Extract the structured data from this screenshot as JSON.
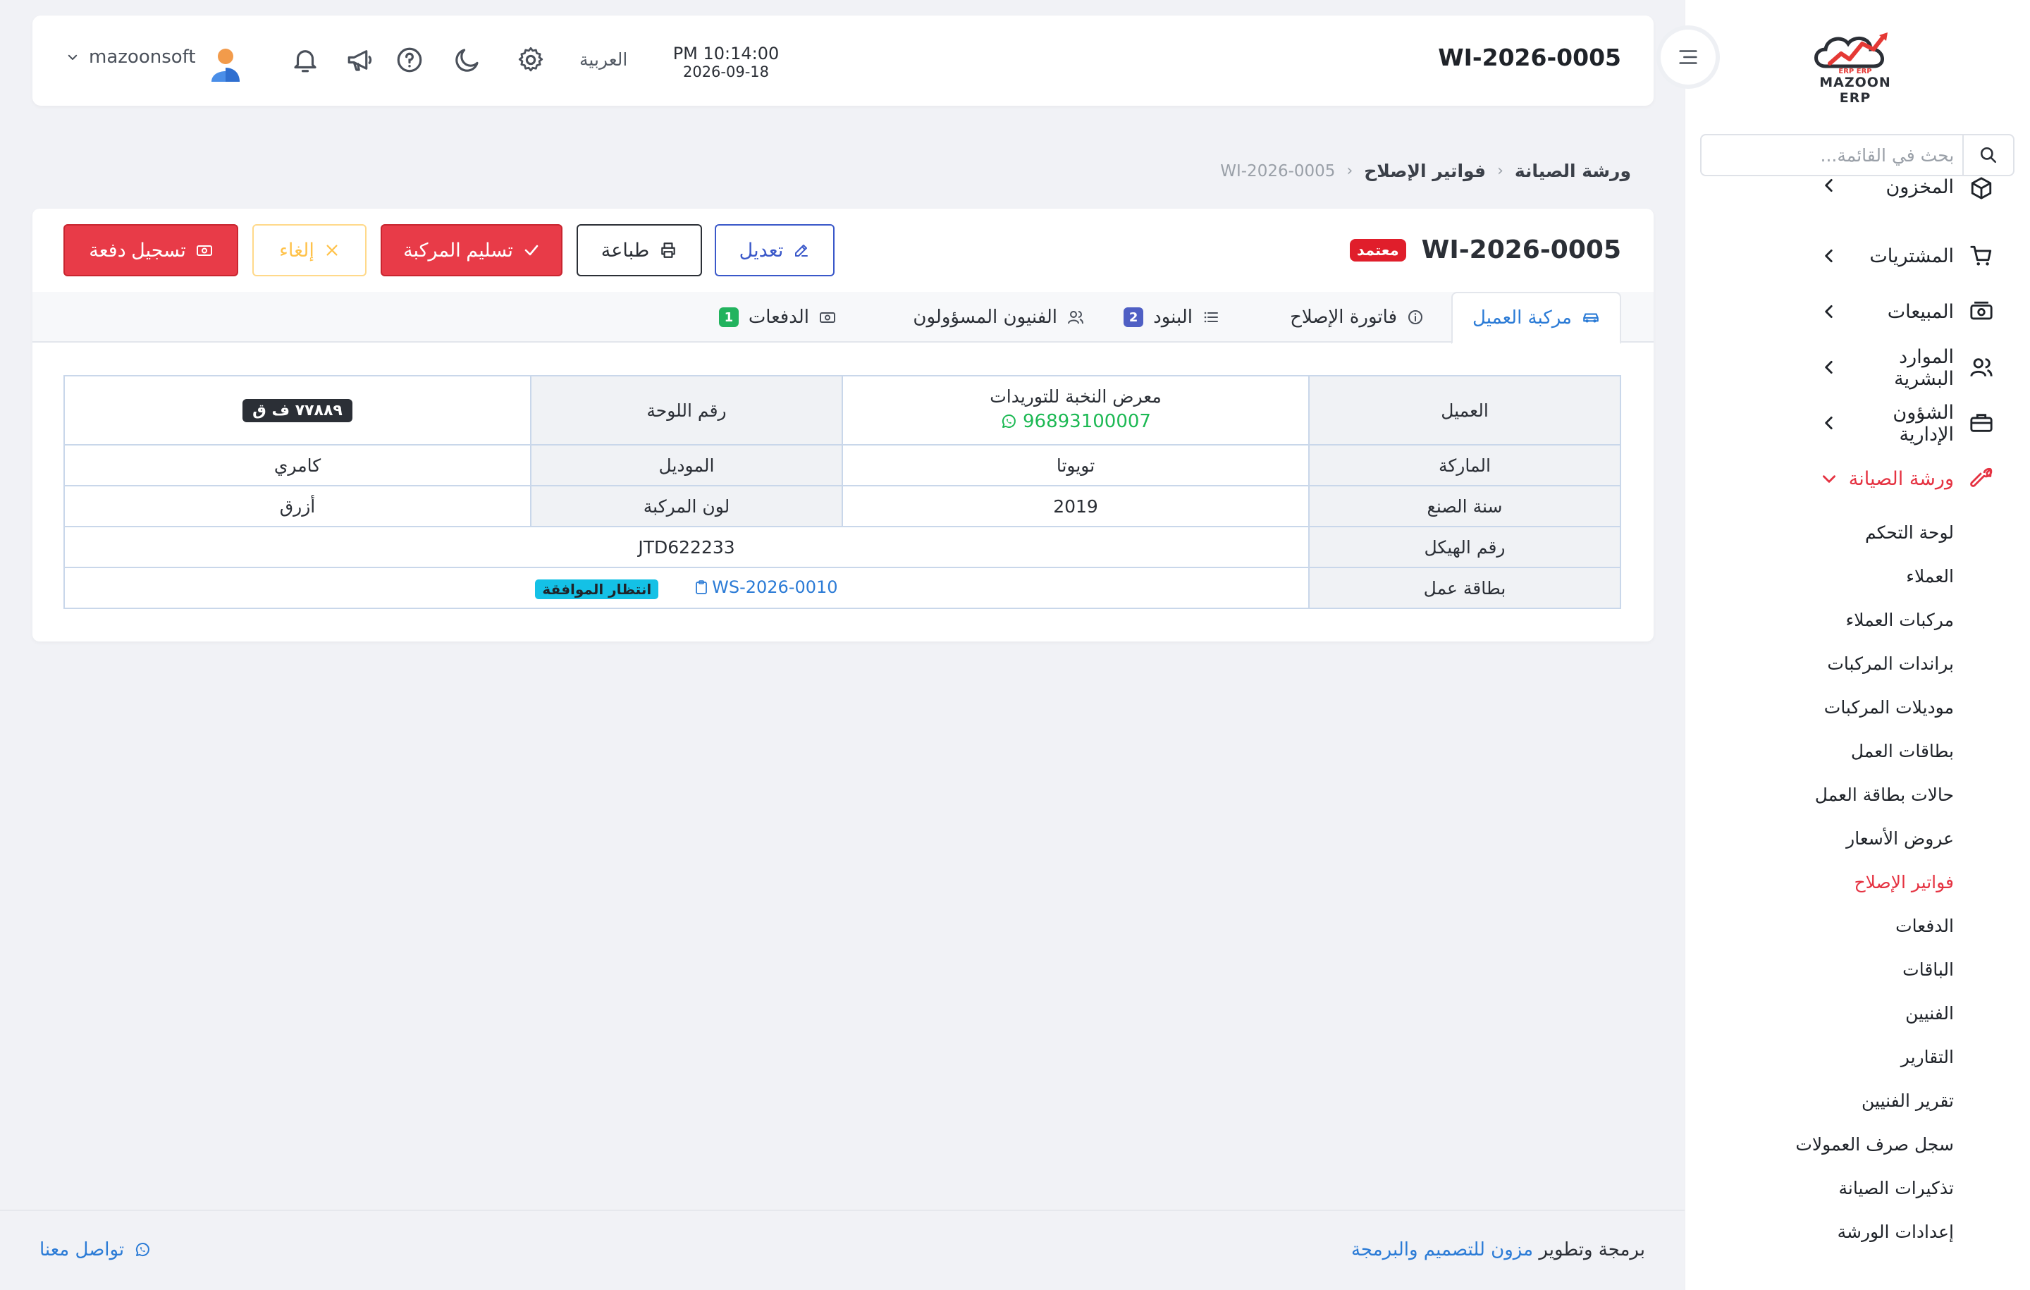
{
  "header": {
    "title": "WI-2026-0005",
    "time": "PM 10:14:00",
    "date": "2026-09-18",
    "language": "العربية",
    "username": "mazoonsoft"
  },
  "logo": {
    "text": "MAZOON ERP",
    "tagline": "ERP ERP"
  },
  "sidebar": {
    "search_placeholder": "بحث في القائمة...",
    "items": [
      {
        "label": "المخزون",
        "icon": "box-icon"
      },
      {
        "label": "المشتريات",
        "icon": "cart-icon"
      },
      {
        "label": "المبيعات",
        "icon": "cash-icon"
      },
      {
        "label": "الموارد البشرية",
        "icon": "users-icon"
      },
      {
        "label": "الشؤون الإدارية",
        "icon": "briefcase-icon"
      },
      {
        "label": "ورشة الصيانة",
        "icon": "wrench-icon",
        "active": true
      }
    ],
    "subitems": [
      "لوحة التحكم",
      "العملاء",
      "مركبات العملاء",
      "براندات المركبات",
      "موديلات المركبات",
      "بطاقات العمل",
      "حالات بطاقة العمل",
      "عروض الأسعار",
      "فواتير الإصلاح",
      "الدفعات",
      "الباقات",
      "الفنيين",
      "التقارير",
      "تقرير الفنيين",
      "سجل صرف العمولات",
      "تذكيرات الصيانة",
      "إعدادات الورشة"
    ],
    "active_subitem_index": 8
  },
  "breadcrumb": {
    "level1": "ورشة الصيانة",
    "level2": "فواتير الإصلاح",
    "current": "WI-2026-0005"
  },
  "invoice": {
    "number": "WI-2026-0005",
    "status": "معتمد"
  },
  "buttons": {
    "edit": "تعديل",
    "print": "طباعة",
    "deliver": "تسليم المركبة",
    "cancel": "إلغاء",
    "payment": "تسجيل دفعة"
  },
  "tabs": [
    {
      "label": "مركبة العميل",
      "icon": "car-icon"
    },
    {
      "label": "فاتورة الإصلاح",
      "icon": "info-icon"
    },
    {
      "label": "البنود",
      "icon": "list-icon",
      "count": "2"
    },
    {
      "label": "الفنيون المسؤولون",
      "icon": "users-icon"
    },
    {
      "label": "الدفعات",
      "icon": "cash-icon",
      "count": "1"
    }
  ],
  "vehicle": {
    "customer_label": "العميل",
    "customer_name": "معرض النخبة للتوريدات",
    "customer_phone": "96893100007",
    "plate_label": "رقم اللوحة",
    "plate": "٧٧٨٨٩ ف ق",
    "brand_label": "الماركة",
    "brand": "تويوتا",
    "model_label": "الموديل",
    "model": "كامري",
    "year_label": "سنة الصنع",
    "year": "2019",
    "color_label": "لون المركبة",
    "color": "أزرق",
    "chassis_label": "رقم الهيكل",
    "chassis": "JTD622233",
    "jobcard_label": "بطاقة عمل",
    "jobcard": "WS-2026-0010",
    "jobcard_status": "انتظار الموافقة"
  },
  "footer": {
    "credit_prefix": "برمجة وتطوير",
    "credit_brand": "مزون للتصميم والبرمجة",
    "contact": "تواصل معنا"
  },
  "colors": {
    "accent_red": "#e53342",
    "link_blue": "#2b7bd6",
    "whatsapp_green": "#1db954",
    "pending_cyan": "#14c1e6"
  }
}
